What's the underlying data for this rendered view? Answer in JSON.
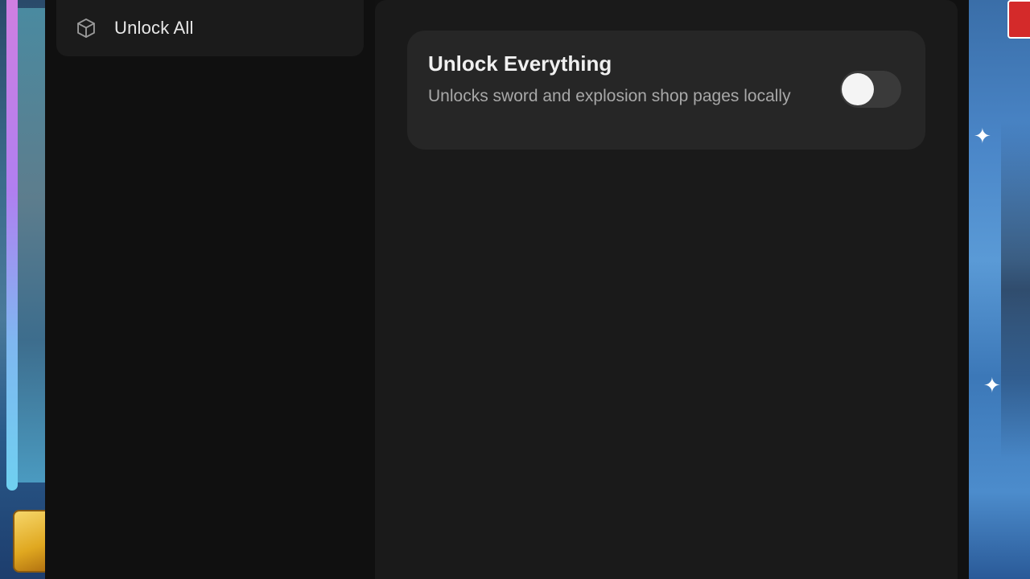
{
  "sidebar": {
    "items": [
      {
        "label": "Unlock All",
        "icon": "cube-icon",
        "active": true
      }
    ]
  },
  "main": {
    "settings": [
      {
        "title": "Unlock Everything",
        "description": "Unlocks sword and explosion shop pages locally",
        "enabled": false
      }
    ]
  },
  "colors": {
    "panel_bg": "#111111",
    "content_bg": "#1a1a1a",
    "card_bg": "#262626",
    "toggle_off": "#3a3a3a",
    "knob": "#f4f4f4"
  }
}
